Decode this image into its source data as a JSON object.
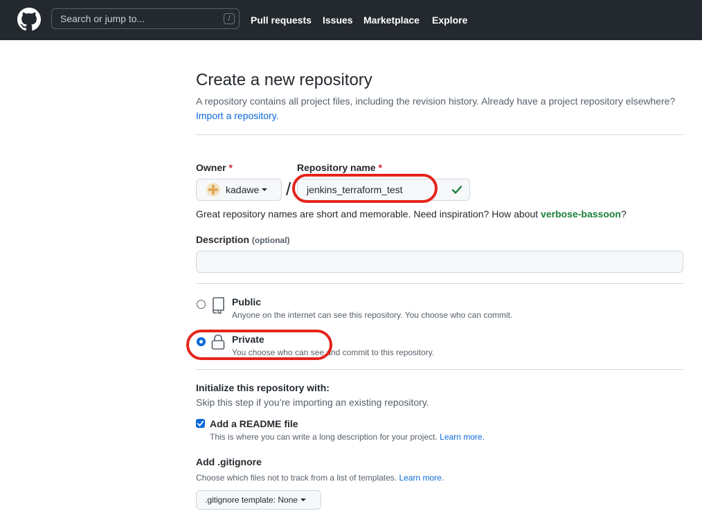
{
  "header": {
    "search_placeholder": "Search or jump to...",
    "search_shortcut": "/",
    "nav": [
      "Pull requests",
      "Issues",
      "Marketplace",
      "Explore"
    ]
  },
  "page": {
    "title": "Create a new repository",
    "subtitle_text": "A repository contains all project files, including the revision history. Already have a project repository elsewhere?",
    "import_link": "Import a repository."
  },
  "owner": {
    "label": "Owner",
    "required_mark": "*",
    "value": "kadawe"
  },
  "repo": {
    "label": "Repository name",
    "required_mark": "*",
    "value": "jenkins_terraform_test",
    "separator": "/"
  },
  "hint": {
    "text": "Great repository names are short and memorable. Need inspiration? How about",
    "suggestion": "verbose-bassoon",
    "end": "?"
  },
  "description": {
    "label": "Description",
    "optional": "(optional)",
    "value": ""
  },
  "visibility": {
    "public": {
      "title": "Public",
      "desc": "Anyone on the internet can see this repository. You choose who can commit.",
      "selected": false
    },
    "private": {
      "title": "Private",
      "desc": "You choose who can see and commit to this repository.",
      "selected": true
    }
  },
  "init": {
    "title": "Initialize this repository with:",
    "subtitle": "Skip this step if you’re importing an existing repository.",
    "readme_label": "Add a README file",
    "readme_checked": true,
    "readme_desc": "This is where you can write a long description for your project.",
    "readme_link": "Learn more."
  },
  "gitignore": {
    "title": "Add .gitignore",
    "desc": "Choose which files not to track from a list of templates.",
    "link": "Learn more.",
    "select_label": ".gitignore template: None"
  },
  "colors": {
    "header_bg": "#24292f",
    "link": "#0969da",
    "success": "#1a7f37",
    "annotation_red": "#e5241b"
  }
}
